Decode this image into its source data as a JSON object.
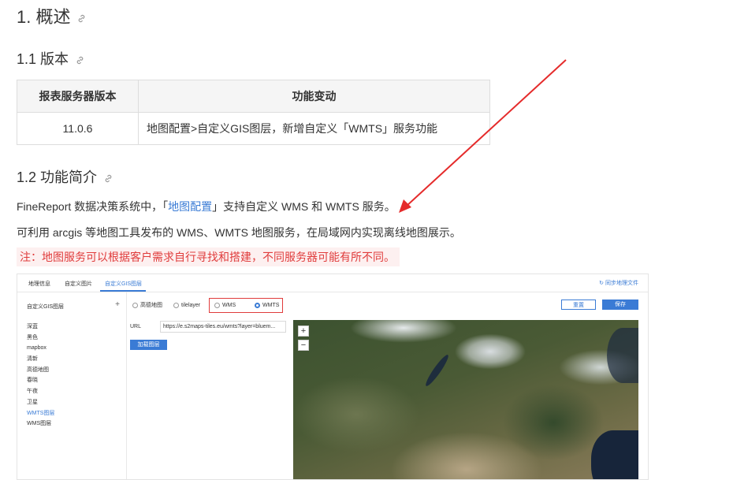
{
  "heading1": "1. 概述",
  "heading_version": "1.1 版本",
  "version_table": {
    "headers": [
      "报表服务器版本",
      "功能变动"
    ],
    "rows": [
      [
        "11.0.6",
        "地图配置>自定义GIS图层，新增自定义「WMTS」服务功能"
      ]
    ]
  },
  "heading_intro": "1.2 功能简介",
  "intro": {
    "prefix": "FineReport 数据决策系统中，「",
    "link": "地图配置",
    "suffix": "」支持自定义 WMS 和 WMTS 服务。"
  },
  "paragraph2": "可利用 arcgis 等地图工具发布的 WMS、WMTS 地图服务，在局域网内实现离线地图展示。",
  "note": "注：地图服务可以根据客户需求自行寻找和搭建，不同服务器可能有所不同。",
  "screenshot": {
    "tabs": [
      "地理信息",
      "自定义图片",
      "自定义GIS图层"
    ],
    "sync_label": "同步地理文件",
    "left_title": "自定义GIS图层",
    "left_add": "+",
    "layers": [
      "深蓝",
      "黑色",
      "mapbox",
      "清新",
      "高德地图",
      "春晓",
      "午夜",
      "卫星",
      "WMTS图层",
      "WMS图层"
    ],
    "radio_options": [
      "高德地图",
      "tilelayer",
      "WMS",
      "WMTS"
    ],
    "selected_option": "WMTS",
    "reset_label": "重置",
    "save_label": "保存",
    "url_label": "URL",
    "url_value": "https://e.s2maps-tiles.eu/wmts?layer=bluem...",
    "add_layer_label": "加载图层",
    "zoom_in": "+",
    "zoom_out": "−"
  },
  "colors": {
    "link": "#3a7bd5",
    "note_text": "#e03c3c",
    "note_bg": "#fdf0f0",
    "arrow": "#e52b2b"
  },
  "icons": [
    "link-icon",
    "refresh-icon",
    "plus-icon"
  ]
}
